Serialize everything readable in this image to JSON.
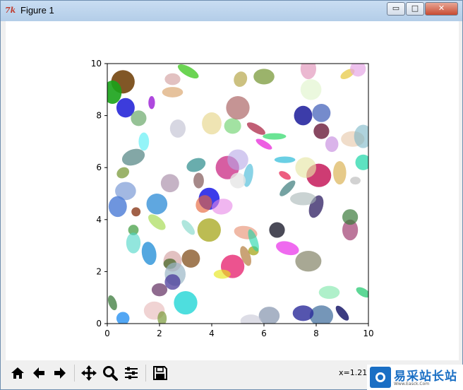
{
  "window": {
    "title": "Figure 1",
    "app_icon_glyph": "7k",
    "buttons": {
      "minimize": "▭",
      "maximize": "□",
      "close": "✕"
    }
  },
  "toolbar": {
    "buttons": [
      {
        "name": "home-icon",
        "glyph": "home"
      },
      {
        "name": "back-arrow-icon",
        "glyph": "back"
      },
      {
        "name": "forward-arrow-icon",
        "glyph": "forward"
      },
      {
        "name": "pan-move-icon",
        "glyph": "move"
      },
      {
        "name": "zoom-magnifier-icon",
        "glyph": "zoom"
      },
      {
        "name": "configure-subplots-icon",
        "glyph": "sliders"
      },
      {
        "name": "save-floppy-icon",
        "glyph": "save"
      }
    ],
    "coordinates_text": "x=1.212"
  },
  "watermark": {
    "title": "易采站长站",
    "subtitle": "Www.Easck.Com",
    "color": "#1a6fc4"
  },
  "chart_data": {
    "type": "scatter",
    "description_kind": "random ellipses",
    "title": "",
    "xlabel": "",
    "ylabel": "",
    "xlim": [
      0,
      10
    ],
    "ylim": [
      0,
      10
    ],
    "xticks": [
      "0",
      "2",
      "4",
      "6",
      "8",
      "10"
    ],
    "yticks": [
      "0",
      "2",
      "4",
      "6",
      "8",
      "10"
    ],
    "grid": false,
    "ellipses": [
      {
        "x": 0.6,
        "y": 9.3,
        "w": 0.9,
        "h": 0.9,
        "angle": 0,
        "color": "#6b3a00",
        "alpha": 0.85
      },
      {
        "x": 0.2,
        "y": 8.9,
        "w": 0.7,
        "h": 0.9,
        "angle": 0,
        "color": "#1aa31a",
        "alpha": 0.9
      },
      {
        "x": 0.7,
        "y": 8.3,
        "w": 0.7,
        "h": 0.75,
        "angle": 0,
        "color": "#1a1ad6",
        "alpha": 0.85
      },
      {
        "x": 1.2,
        "y": 7.9,
        "w": 0.6,
        "h": 0.6,
        "angle": 0,
        "color": "#6aa86a",
        "alpha": 0.7
      },
      {
        "x": 1.4,
        "y": 7.0,
        "w": 0.4,
        "h": 0.7,
        "angle": 0,
        "color": "#6ff0f6",
        "alpha": 0.75
      },
      {
        "x": 1.0,
        "y": 6.4,
        "w": 0.9,
        "h": 0.6,
        "angle": 20,
        "color": "#5a8a88",
        "alpha": 0.75
      },
      {
        "x": 0.6,
        "y": 5.8,
        "w": 0.5,
        "h": 0.4,
        "angle": 30,
        "color": "#7a9a3a",
        "alpha": 0.75
      },
      {
        "x": 0.7,
        "y": 5.1,
        "w": 0.8,
        "h": 0.7,
        "angle": 0,
        "color": "#7a9ad6",
        "alpha": 0.7
      },
      {
        "x": 0.4,
        "y": 4.5,
        "w": 0.7,
        "h": 0.8,
        "angle": 0,
        "color": "#4a7ad6",
        "alpha": 0.8
      },
      {
        "x": 1.9,
        "y": 4.6,
        "w": 0.8,
        "h": 0.8,
        "angle": -10,
        "color": "#2a8ad6",
        "alpha": 0.75
      },
      {
        "x": 1.1,
        "y": 4.3,
        "w": 0.35,
        "h": 0.35,
        "angle": 0,
        "color": "#8a3a1a",
        "alpha": 0.8
      },
      {
        "x": 1.9,
        "y": 3.9,
        "w": 0.8,
        "h": 0.4,
        "angle": -40,
        "color": "#9ad63a",
        "alpha": 0.6
      },
      {
        "x": 1.0,
        "y": 3.6,
        "w": 0.4,
        "h": 0.4,
        "angle": 0,
        "color": "#3a9a3a",
        "alpha": 0.7
      },
      {
        "x": 1.0,
        "y": 3.1,
        "w": 0.55,
        "h": 0.8,
        "angle": 0,
        "color": "#4ad6c6",
        "alpha": 0.6
      },
      {
        "x": 1.6,
        "y": 2.7,
        "w": 0.55,
        "h": 0.9,
        "angle": 10,
        "color": "#1a8ad6",
        "alpha": 0.75
      },
      {
        "x": 2.5,
        "y": 2.4,
        "w": 0.7,
        "h": 0.8,
        "angle": 0,
        "color": "#d6a6a6",
        "alpha": 0.7
      },
      {
        "x": 2.4,
        "y": 2.3,
        "w": 0.5,
        "h": 0.4,
        "angle": 0,
        "color": "#4a6a2a",
        "alpha": 0.75
      },
      {
        "x": 3.2,
        "y": 2.5,
        "w": 0.7,
        "h": 0.7,
        "angle": 0,
        "color": "#8a5a2a",
        "alpha": 0.8
      },
      {
        "x": 2.6,
        "y": 1.9,
        "w": 0.8,
        "h": 0.9,
        "angle": 0,
        "color": "#9ab6c6",
        "alpha": 0.7
      },
      {
        "x": 2.5,
        "y": 1.6,
        "w": 0.6,
        "h": 0.6,
        "angle": 0,
        "color": "#4a3a9a",
        "alpha": 0.75
      },
      {
        "x": 2.0,
        "y": 1.3,
        "w": 0.6,
        "h": 0.5,
        "angle": 0,
        "color": "#6a3a6a",
        "alpha": 0.75
      },
      {
        "x": 3.0,
        "y": 0.8,
        "w": 0.9,
        "h": 0.9,
        "angle": 0,
        "color": "#22d6d6",
        "alpha": 0.8
      },
      {
        "x": 1.8,
        "y": 0.5,
        "w": 0.8,
        "h": 0.7,
        "angle": 0,
        "color": "#e6b6b6",
        "alpha": 0.6
      },
      {
        "x": 0.6,
        "y": 0.2,
        "w": 0.5,
        "h": 0.5,
        "angle": 0,
        "color": "#1a8af0",
        "alpha": 0.75
      },
      {
        "x": 0.2,
        "y": 0.8,
        "w": 0.3,
        "h": 0.6,
        "angle": 20,
        "color": "#3a7a3a",
        "alpha": 0.75
      },
      {
        "x": 2.1,
        "y": 0.2,
        "w": 0.35,
        "h": 0.55,
        "angle": 0,
        "color": "#7a9a3a",
        "alpha": 0.7
      },
      {
        "x": 3.9,
        "y": 4.8,
        "w": 0.8,
        "h": 0.85,
        "angle": 0,
        "color": "#1a1ae6",
        "alpha": 0.85
      },
      {
        "x": 3.7,
        "y": 4.6,
        "w": 0.6,
        "h": 0.7,
        "angle": -30,
        "color": "#e6663a",
        "alpha": 0.65
      },
      {
        "x": 4.4,
        "y": 4.5,
        "w": 0.8,
        "h": 0.6,
        "angle": 10,
        "color": "#e686e6",
        "alpha": 0.6
      },
      {
        "x": 3.9,
        "y": 3.6,
        "w": 0.9,
        "h": 0.9,
        "angle": 0,
        "color": "#a6a61a",
        "alpha": 0.75
      },
      {
        "x": 3.1,
        "y": 3.7,
        "w": 0.3,
        "h": 0.7,
        "angle": 40,
        "color": "#7ad6c6",
        "alpha": 0.6
      },
      {
        "x": 4.8,
        "y": 2.2,
        "w": 0.9,
        "h": 0.9,
        "angle": 0,
        "color": "#e61a6a",
        "alpha": 0.75
      },
      {
        "x": 4.4,
        "y": 1.9,
        "w": 0.65,
        "h": 0.35,
        "angle": 0,
        "color": "#e6e61a",
        "alpha": 0.65
      },
      {
        "x": 5.3,
        "y": 2.6,
        "w": 0.35,
        "h": 0.8,
        "angle": 20,
        "color": "#a6661a",
        "alpha": 0.6
      },
      {
        "x": 5.6,
        "y": 2.8,
        "w": 0.4,
        "h": 0.35,
        "angle": 0,
        "color": "#a6a61a",
        "alpha": 0.75
      },
      {
        "x": 5.3,
        "y": 3.5,
        "w": 0.9,
        "h": 0.5,
        "angle": -10,
        "color": "#e68a6a",
        "alpha": 0.6
      },
      {
        "x": 5.6,
        "y": 3.2,
        "w": 0.3,
        "h": 0.9,
        "angle": 20,
        "color": "#1ad6a6",
        "alpha": 0.6
      },
      {
        "x": 6.5,
        "y": 3.6,
        "w": 0.6,
        "h": 0.6,
        "angle": 0,
        "color": "#2a2a3a",
        "alpha": 0.85
      },
      {
        "x": 6.9,
        "y": 2.9,
        "w": 0.9,
        "h": 0.5,
        "angle": -15,
        "color": "#e61ae6",
        "alpha": 0.65
      },
      {
        "x": 7.7,
        "y": 2.4,
        "w": 1.0,
        "h": 0.8,
        "angle": 0,
        "color": "#7a7a5a",
        "alpha": 0.65
      },
      {
        "x": 8.2,
        "y": 0.3,
        "w": 0.9,
        "h": 0.8,
        "angle": 0,
        "color": "#3a6a9a",
        "alpha": 0.7
      },
      {
        "x": 7.5,
        "y": 0.4,
        "w": 0.8,
        "h": 0.6,
        "angle": 0,
        "color": "#2a2a9a",
        "alpha": 0.8
      },
      {
        "x": 9.0,
        "y": 0.4,
        "w": 0.3,
        "h": 0.7,
        "angle": 40,
        "color": "#1a1a6a",
        "alpha": 0.85
      },
      {
        "x": 8.5,
        "y": 1.2,
        "w": 0.8,
        "h": 0.5,
        "angle": 0,
        "color": "#7ae6a6",
        "alpha": 0.6
      },
      {
        "x": 9.8,
        "y": 1.2,
        "w": 0.6,
        "h": 0.3,
        "angle": -30,
        "color": "#1ac66a",
        "alpha": 0.7
      },
      {
        "x": 6.2,
        "y": 0.3,
        "w": 0.8,
        "h": 0.7,
        "angle": 0,
        "color": "#7a8aa6",
        "alpha": 0.65
      },
      {
        "x": 5.5,
        "y": 0.1,
        "w": 0.8,
        "h": 0.5,
        "angle": 0,
        "color": "#c6c6d6",
        "alpha": 0.6
      },
      {
        "x": 8.1,
        "y": 5.7,
        "w": 0.95,
        "h": 0.9,
        "angle": 0,
        "color": "#c61a5a",
        "alpha": 0.85
      },
      {
        "x": 7.6,
        "y": 6.0,
        "w": 0.8,
        "h": 0.8,
        "angle": 0,
        "color": "#e6e6a6",
        "alpha": 0.65
      },
      {
        "x": 8.9,
        "y": 5.8,
        "w": 0.5,
        "h": 0.9,
        "angle": 0,
        "color": "#d6a63a",
        "alpha": 0.6
      },
      {
        "x": 9.8,
        "y": 6.2,
        "w": 0.6,
        "h": 0.6,
        "angle": 0,
        "color": "#1ad6a6",
        "alpha": 0.7
      },
      {
        "x": 8.0,
        "y": 4.5,
        "w": 0.5,
        "h": 0.9,
        "angle": -20,
        "color": "#3a2a6a",
        "alpha": 0.8
      },
      {
        "x": 9.3,
        "y": 3.6,
        "w": 0.6,
        "h": 0.8,
        "angle": 0,
        "color": "#a64a7a",
        "alpha": 0.75
      },
      {
        "x": 9.3,
        "y": 4.1,
        "w": 0.6,
        "h": 0.6,
        "angle": 0,
        "color": "#3a7a3a",
        "alpha": 0.7
      },
      {
        "x": 7.5,
        "y": 4.8,
        "w": 1.0,
        "h": 0.5,
        "angle": 0,
        "color": "#a6b6b6",
        "alpha": 0.6
      },
      {
        "x": 6.9,
        "y": 5.2,
        "w": 0.3,
        "h": 0.8,
        "angle": -45,
        "color": "#3a7a7a",
        "alpha": 0.7
      },
      {
        "x": 6.8,
        "y": 6.3,
        "w": 0.8,
        "h": 0.25,
        "angle": 0,
        "color": "#1ab6d6",
        "alpha": 0.65
      },
      {
        "x": 6.8,
        "y": 5.7,
        "w": 0.5,
        "h": 0.25,
        "angle": -30,
        "color": "#e61a4a",
        "alpha": 0.7
      },
      {
        "x": 4.6,
        "y": 6.0,
        "w": 0.9,
        "h": 0.9,
        "angle": 0,
        "color": "#c61a7a",
        "alpha": 0.7
      },
      {
        "x": 5.0,
        "y": 6.3,
        "w": 0.8,
        "h": 0.8,
        "angle": 0,
        "color": "#b6a6e6",
        "alpha": 0.6
      },
      {
        "x": 5.4,
        "y": 5.7,
        "w": 0.35,
        "h": 0.9,
        "angle": -10,
        "color": "#3ab6d6",
        "alpha": 0.6
      },
      {
        "x": 5.0,
        "y": 5.5,
        "w": 0.6,
        "h": 0.6,
        "angle": 0,
        "color": "#e6e6e6",
        "alpha": 0.8
      },
      {
        "x": 3.4,
        "y": 6.1,
        "w": 0.75,
        "h": 0.5,
        "angle": 20,
        "color": "#2a8a8a",
        "alpha": 0.7
      },
      {
        "x": 3.5,
        "y": 5.5,
        "w": 0.4,
        "h": 0.6,
        "angle": 0,
        "color": "#6a3a3a",
        "alpha": 0.6
      },
      {
        "x": 2.4,
        "y": 5.4,
        "w": 0.7,
        "h": 0.7,
        "angle": 0,
        "color": "#a68aa6",
        "alpha": 0.65
      },
      {
        "x": 4.0,
        "y": 7.7,
        "w": 0.75,
        "h": 0.85,
        "angle": 0,
        "color": "#e6d68a",
        "alpha": 0.65
      },
      {
        "x": 4.8,
        "y": 7.6,
        "w": 0.65,
        "h": 0.6,
        "angle": 0,
        "color": "#7ad67a",
        "alpha": 0.7
      },
      {
        "x": 5.0,
        "y": 8.3,
        "w": 0.9,
        "h": 0.9,
        "angle": 0,
        "color": "#a65a5a",
        "alpha": 0.65
      },
      {
        "x": 5.7,
        "y": 7.5,
        "w": 0.3,
        "h": 0.8,
        "angle": 60,
        "color": "#a61a3a",
        "alpha": 0.7
      },
      {
        "x": 6.4,
        "y": 7.2,
        "w": 0.9,
        "h": 0.25,
        "angle": 0,
        "color": "#1ad65a",
        "alpha": 0.65
      },
      {
        "x": 6.0,
        "y": 6.9,
        "w": 0.7,
        "h": 0.25,
        "angle": -30,
        "color": "#e61ad6",
        "alpha": 0.7
      },
      {
        "x": 7.5,
        "y": 8.0,
        "w": 0.7,
        "h": 0.75,
        "angle": 0,
        "color": "#1a1a9a",
        "alpha": 0.85
      },
      {
        "x": 8.2,
        "y": 8.1,
        "w": 0.7,
        "h": 0.7,
        "angle": 0,
        "color": "#3a5ab6",
        "alpha": 0.7
      },
      {
        "x": 8.2,
        "y": 7.4,
        "w": 0.6,
        "h": 0.6,
        "angle": 0,
        "color": "#6a1a3a",
        "alpha": 0.8
      },
      {
        "x": 8.6,
        "y": 6.9,
        "w": 0.5,
        "h": 0.6,
        "angle": 0,
        "color": "#b66ad6",
        "alpha": 0.5
      },
      {
        "x": 9.4,
        "y": 7.1,
        "w": 0.9,
        "h": 0.6,
        "angle": 0,
        "color": "#e6c6a6",
        "alpha": 0.6
      },
      {
        "x": 9.8,
        "y": 7.2,
        "w": 0.7,
        "h": 0.9,
        "angle": 0,
        "color": "#7ab6c6",
        "alpha": 0.6
      },
      {
        "x": 7.8,
        "y": 9.0,
        "w": 0.8,
        "h": 0.8,
        "angle": 0,
        "color": "#e6f6d6",
        "alpha": 0.8
      },
      {
        "x": 7.7,
        "y": 9.8,
        "w": 0.6,
        "h": 0.8,
        "angle": 0,
        "color": "#e6a6c6",
        "alpha": 0.8
      },
      {
        "x": 6.0,
        "y": 9.5,
        "w": 0.8,
        "h": 0.6,
        "angle": 0,
        "color": "#7a9a3a",
        "alpha": 0.75
      },
      {
        "x": 5.1,
        "y": 9.4,
        "w": 0.5,
        "h": 0.6,
        "angle": -20,
        "color": "#b6a64a",
        "alpha": 0.7
      },
      {
        "x": 3.1,
        "y": 9.7,
        "w": 0.9,
        "h": 0.35,
        "angle": -30,
        "color": "#3ac61a",
        "alpha": 0.75
      },
      {
        "x": 2.5,
        "y": 9.4,
        "w": 0.6,
        "h": 0.45,
        "angle": 0,
        "color": "#d6a6a6",
        "alpha": 0.7
      },
      {
        "x": 2.5,
        "y": 8.9,
        "w": 0.8,
        "h": 0.4,
        "angle": 0,
        "color": "#d69a5a",
        "alpha": 0.6
      },
      {
        "x": 2.7,
        "y": 7.5,
        "w": 0.6,
        "h": 0.7,
        "angle": 0,
        "color": "#c6c6d6",
        "alpha": 0.7
      },
      {
        "x": 1.7,
        "y": 8.5,
        "w": 0.25,
        "h": 0.5,
        "angle": 0,
        "color": "#9a1ad6",
        "alpha": 0.8
      },
      {
        "x": 9.2,
        "y": 9.6,
        "w": 0.6,
        "h": 0.3,
        "angle": 30,
        "color": "#e6c63a",
        "alpha": 0.7
      },
      {
        "x": 9.6,
        "y": 9.8,
        "w": 0.6,
        "h": 0.6,
        "angle": 0,
        "color": "#e6a6e6",
        "alpha": 0.7
      },
      {
        "x": 9.5,
        "y": 5.5,
        "w": 0.4,
        "h": 0.3,
        "angle": 0,
        "color": "#a6a6a6",
        "alpha": 0.5
      }
    ]
  }
}
